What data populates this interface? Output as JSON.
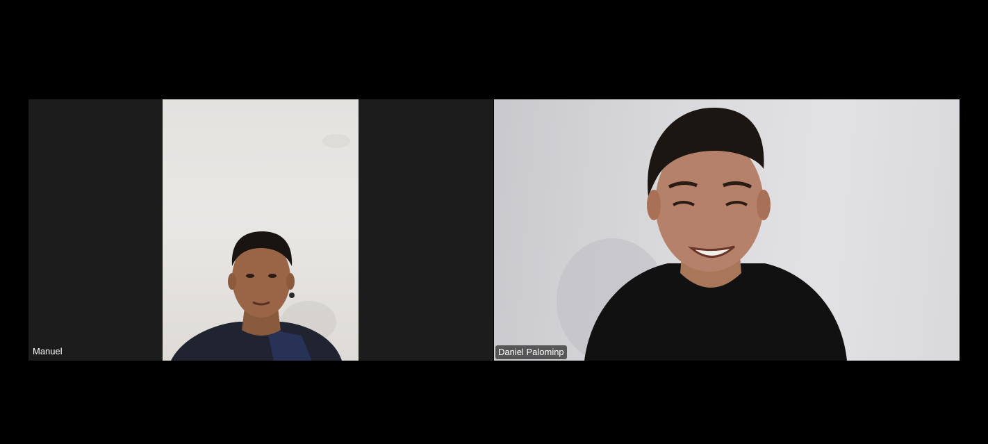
{
  "meeting": {
    "layout": "gallery-view",
    "participants": [
      {
        "name": "Manuel",
        "video": "on"
      },
      {
        "name": "Daniel Palominp",
        "video": "on"
      }
    ]
  },
  "colors": {
    "background": "#000000",
    "tile_background": "#1c1c1c",
    "name_label_text": "#ffffff",
    "name_label_bg": "#282828"
  }
}
